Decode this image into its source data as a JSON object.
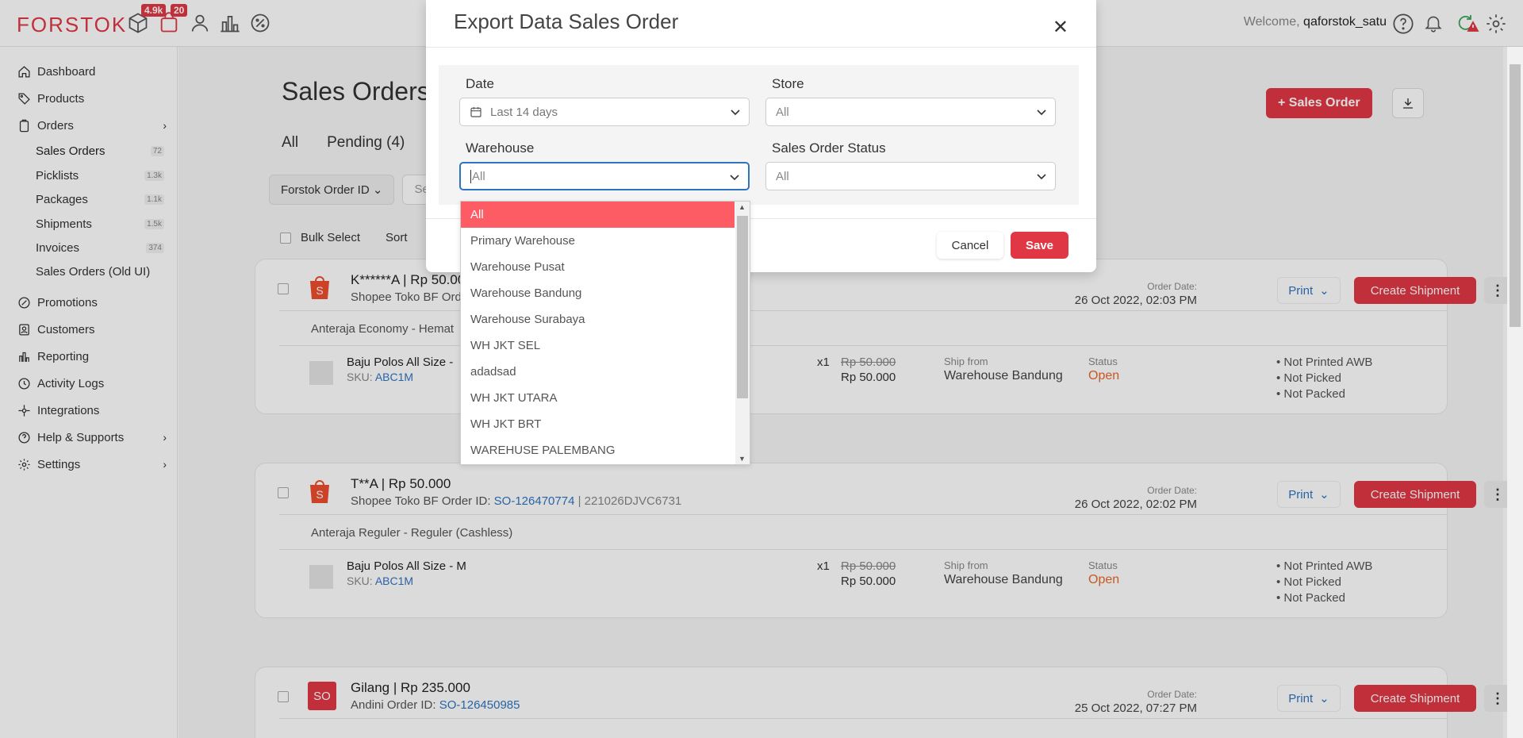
{
  "topbar": {
    "logo": "FORSTOK",
    "badge_products": "4.9k",
    "badge_orders": "20",
    "welcome_prefix": "Welcome,",
    "username": "qaforstok_satu"
  },
  "sidebar": {
    "items": [
      {
        "label": "Dashboard",
        "icon": "home-icon"
      },
      {
        "label": "Products",
        "icon": "tag-icon"
      },
      {
        "label": "Orders",
        "icon": "clipboard-icon"
      },
      {
        "label": "Promotions",
        "icon": "percent-icon"
      },
      {
        "label": "Customers",
        "icon": "contact-icon"
      },
      {
        "label": "Reporting",
        "icon": "bar-chart-icon"
      },
      {
        "label": "Activity Logs",
        "icon": "history-icon"
      },
      {
        "label": "Integrations",
        "icon": "integration-icon"
      },
      {
        "label": "Help & Supports",
        "icon": "help-icon"
      },
      {
        "label": "Settings",
        "icon": "gear-icon"
      }
    ],
    "orders_sub": [
      {
        "label": "Sales Orders",
        "count": "72"
      },
      {
        "label": "Picklists",
        "count": "1.3k"
      },
      {
        "label": "Packages",
        "count": "1.1k"
      },
      {
        "label": "Shipments",
        "count": "1.5k"
      },
      {
        "label": "Invoices",
        "count": "374"
      },
      {
        "label": "Sales Orders (Old UI)",
        "count": ""
      }
    ]
  },
  "main": {
    "title": "Sales Orders",
    "tabs": [
      "All",
      "Pending (4)"
    ],
    "add_button": "+ Sales Order",
    "filter_button": "Forstok Order ID",
    "search_placeholder": "Sea",
    "bulk_select": "Bulk Select",
    "sort_label": "Sort",
    "print_label": "Print",
    "create_shipment_label": "Create Shipment",
    "order_date_label": "Order Date:",
    "ship_from_label": "Ship from",
    "status_label": "Status",
    "sku_label": "SKU:",
    "orders": [
      {
        "title": "K******A | Rp 50.00",
        "store": "Shopee Toko BF",
        "order_id_prefix": "Ord",
        "order_id": "",
        "ext_id": "",
        "date": "26 Oct 2022, 02:03 PM",
        "courier": "Anteraja Economy - Hemat",
        "item_name": "Baju Polos All Size -",
        "sku": "ABC1M",
        "qty": "x1",
        "price_old": "Rp 50.000",
        "price_new": "Rp 50.000",
        "ship_from": "Warehouse Bandung",
        "status": "Open",
        "flags": [
          "• Not Printed AWB",
          "• Not Picked",
          "• Not Packed"
        ]
      },
      {
        "title": "T**A | Rp 50.000",
        "store": "Shopee Toko BF",
        "order_id_prefix": "Order ID:",
        "order_id": "SO-126470774",
        "ext_id": "| 221026DJVC6731",
        "date": "26 Oct 2022, 02:02 PM",
        "courier": "Anteraja Reguler - Reguler (Cashless)",
        "item_name": "Baju Polos All Size - M",
        "sku": "ABC1M",
        "qty": "x1",
        "price_old": "Rp 50.000",
        "price_new": "Rp 50.000",
        "ship_from": "Warehouse Bandung",
        "status": "Open",
        "flags": [
          "• Not Printed AWB",
          "• Not Picked",
          "• Not Packed"
        ]
      },
      {
        "title": "Gilang | Rp 235.000",
        "store": "Andini",
        "order_id_prefix": "Order ID:",
        "order_id": "SO-126450985",
        "ext_id": "",
        "date": "25 Oct 2022, 07:27 PM",
        "icon_text": "SO"
      }
    ]
  },
  "modal": {
    "title": "Export Data Sales Order",
    "date_label": "Date",
    "date_value": "Last 14 days",
    "store_label": "Store",
    "store_value": "All",
    "warehouse_label": "Warehouse",
    "warehouse_value": "All",
    "status_label": "Sales Order Status",
    "status_value": "All",
    "cancel": "Cancel",
    "save": "Save",
    "warehouse_options": [
      "All",
      "Primary Warehouse",
      "Warehouse Pusat",
      "Warehouse Bandung",
      "Warehouse Surabaya",
      "WH JKT SEL",
      "adadsad",
      "WH JKT UTARA",
      "WH JKT BRT",
      "WAREHUSE PALEMBANG"
    ]
  },
  "colors": {
    "brand": "#e03744",
    "link": "#2f74c0",
    "status_open": "#e8672a",
    "option_selected": "#fe5c65"
  }
}
